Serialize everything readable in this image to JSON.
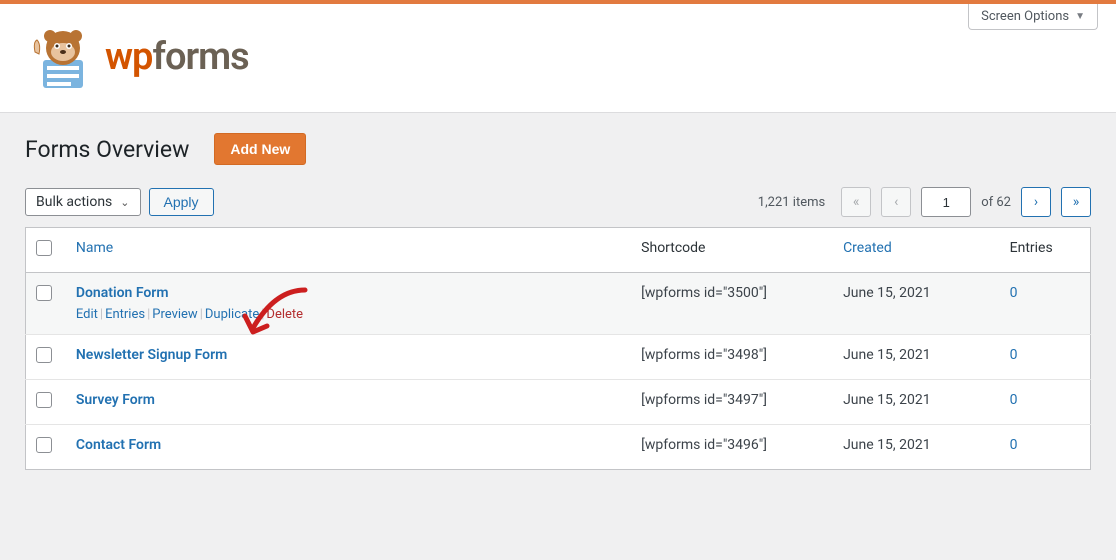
{
  "screenOptions": "Screen Options",
  "logo": {
    "wp": "wp",
    "forms": "forms"
  },
  "pageTitle": "Forms Overview",
  "addNew": "Add New",
  "bulkActions": "Bulk actions",
  "apply": "Apply",
  "pagination": {
    "itemsText": "1,221 items",
    "current": "1",
    "totalText": "of 62",
    "first": "«",
    "prev": "‹",
    "next": "›",
    "last": "»"
  },
  "columns": {
    "name": "Name",
    "shortcode": "Shortcode",
    "created": "Created",
    "entries": "Entries"
  },
  "rowActions": {
    "edit": "Edit",
    "entries": "Entries",
    "preview": "Preview",
    "duplicate": "Duplicate",
    "delete": "Delete"
  },
  "rows": [
    {
      "title": "Donation Form",
      "shortcode": "[wpforms id=\"3500\"]",
      "created": "June 15, 2021",
      "entries": "0",
      "showActions": true
    },
    {
      "title": "Newsletter Signup Form",
      "shortcode": "[wpforms id=\"3498\"]",
      "created": "June 15, 2021",
      "entries": "0",
      "showActions": false
    },
    {
      "title": "Survey Form",
      "shortcode": "[wpforms id=\"3497\"]",
      "created": "June 15, 2021",
      "entries": "0",
      "showActions": false
    },
    {
      "title": "Contact Form",
      "shortcode": "[wpforms id=\"3496\"]",
      "created": "June 15, 2021",
      "entries": "0",
      "showActions": false
    }
  ],
  "annotationColor": "#cc1f1f"
}
